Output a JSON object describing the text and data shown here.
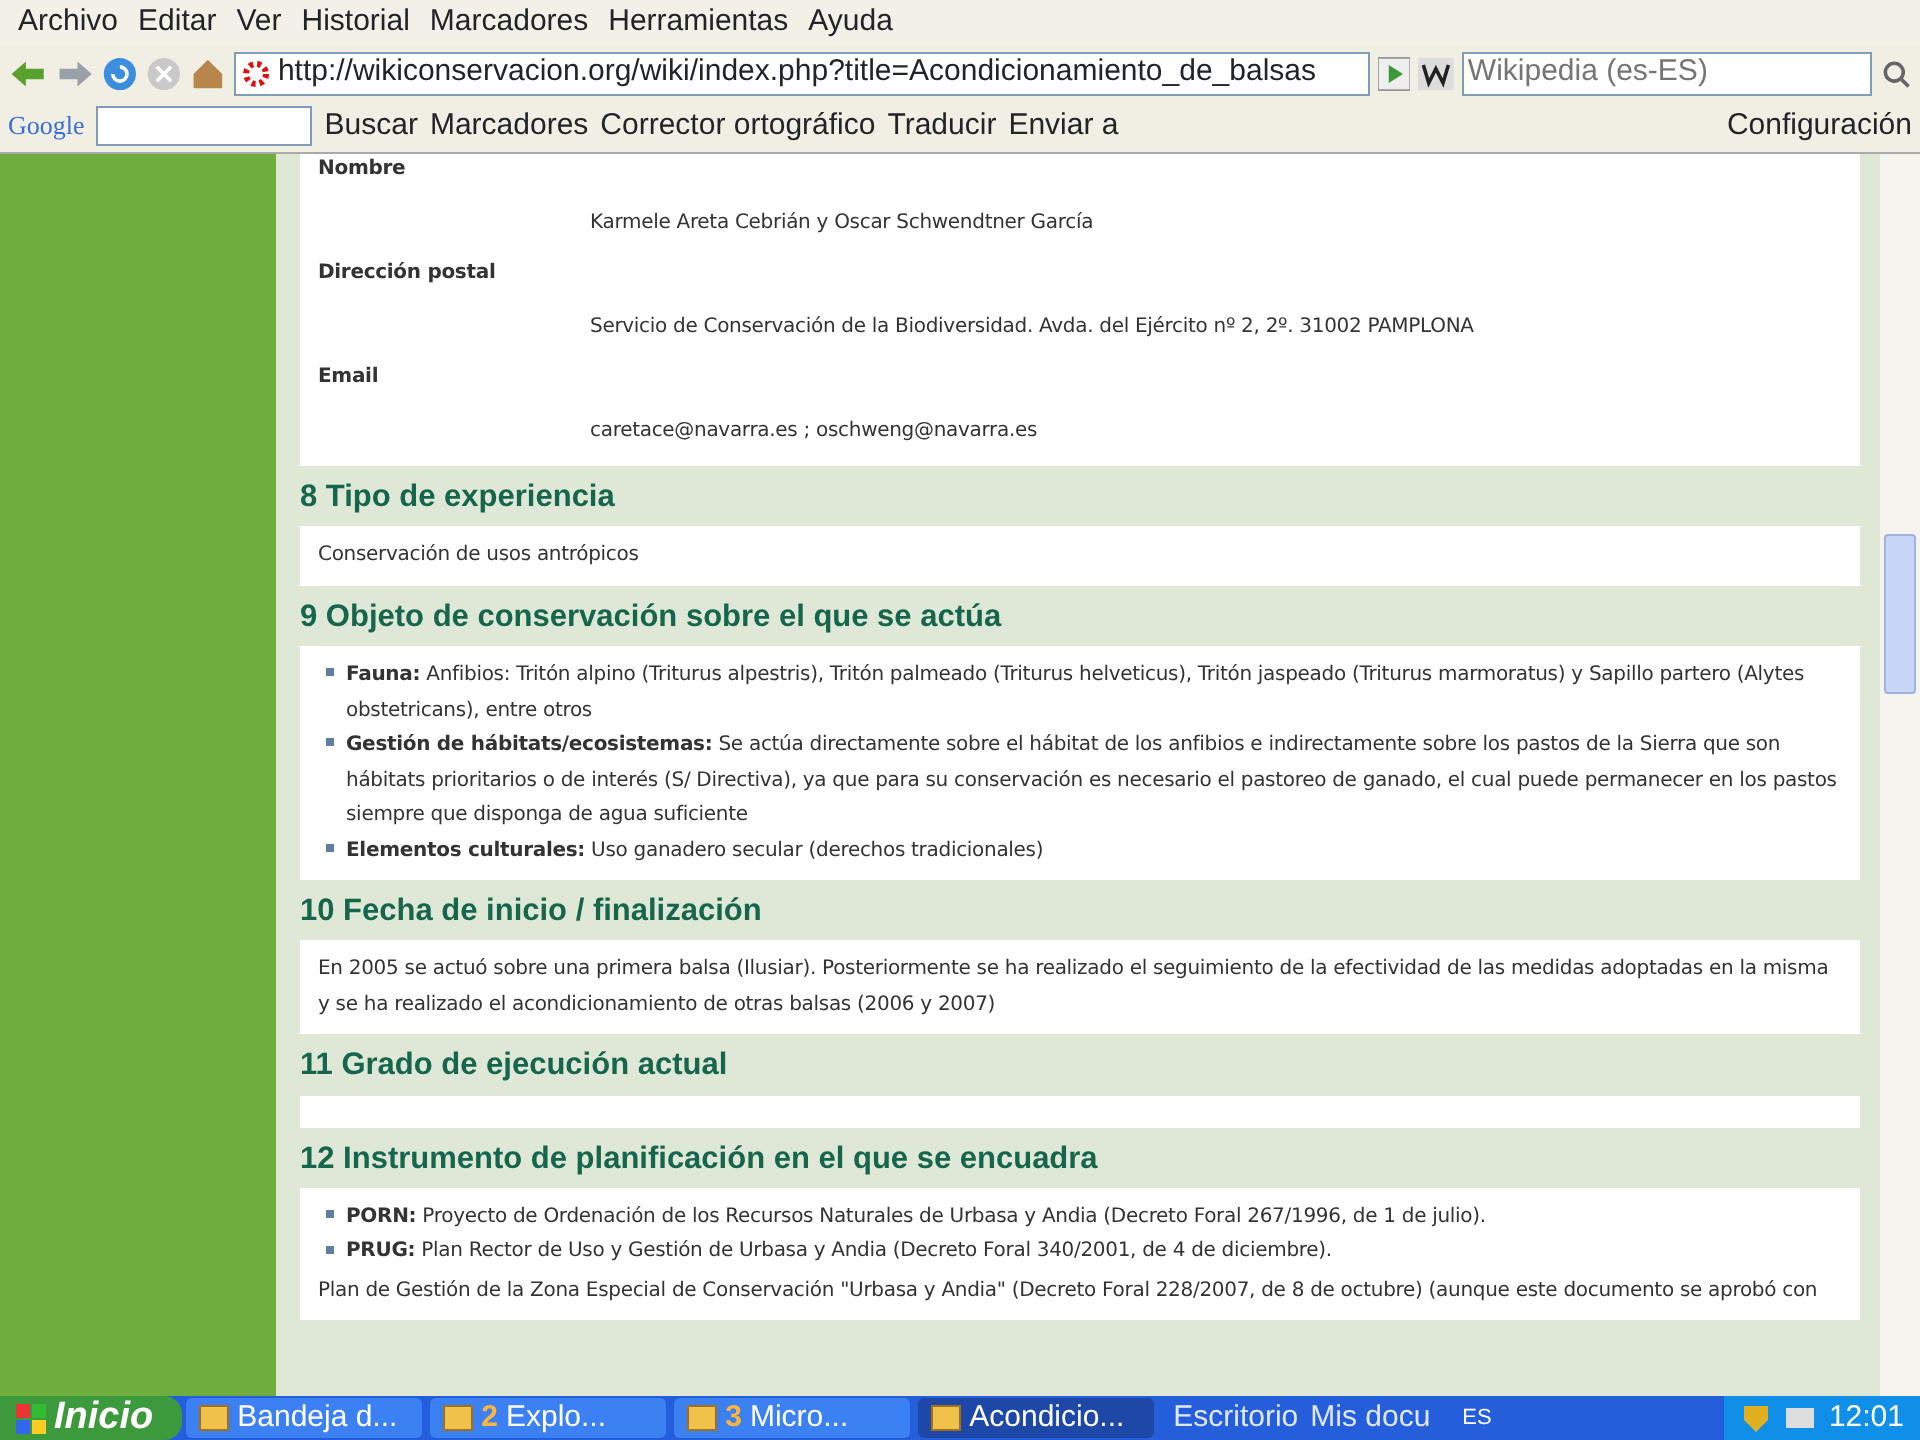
{
  "menu": [
    "Archivo",
    "Editar",
    "Ver",
    "Historial",
    "Marcadores",
    "Herramientas",
    "Ayuda"
  ],
  "navigation": {
    "url": "http://wikiconservacion.org/wiki/index.php?title=Acondicionamiento_de_balsas",
    "search_placeholder": "Wikipedia (es-ES)"
  },
  "google_toolbar": {
    "logo": "Google",
    "items": [
      "Buscar",
      "Marcadores",
      "Corrector ortográfico",
      "Traducir",
      "Enviar a"
    ],
    "settings": "Configuración"
  },
  "contact": [
    {
      "label": "Nombre",
      "value": "Karmele Areta Cebrián y Oscar Schwendtner García"
    },
    {
      "label": "Dirección postal",
      "value": "Servicio de Conservación de la Biodiversidad. Avda. del Ejército nº 2, 2º. 31002 PAMPLONA"
    },
    {
      "label": "Email",
      "value": "caretace@navarra.es ; oschweng@navarra.es"
    }
  ],
  "sections": [
    {
      "heading": "8 Tipo de experiencia",
      "paragraphs": [
        "Conservación de usos antrópicos"
      ]
    },
    {
      "heading": "9 Objeto de conservación sobre el que se actúa",
      "items": [
        "**Fauna:** Anfibios: Tritón alpino (Triturus alpestris), Tritón palmeado (Triturus helveticus), Tritón jaspeado (Triturus marmoratus) y Sapillo partero (Alytes obstetricans), entre otros",
        "**Gestión de hábitats/ecosistemas:** Se actúa directamente sobre el hábitat de los anfibios e indirectamente sobre los pastos de la Sierra que son hábitats prioritarios o de interés (S/ Directiva), ya que para su conservación es necesario el pastoreo de ganado, el cual puede permanecer en los pastos siempre que disponga de agua suficiente",
        "**Elementos culturales:** Uso ganadero secular (derechos tradicionales)"
      ]
    },
    {
      "heading": "10 Fecha de inicio / finalización",
      "paragraphs": [
        "En 2005 se actuó sobre una primera balsa (Ilusiar). Posteriormente se ha realizado el seguimiento de la efectividad de las medidas adoptadas en la misma y se ha realizado el acondicionamiento de otras balsas (2006 y 2007)"
      ]
    },
    {
      "heading": "11 Grado de ejecución actual"
    },
    {
      "heading": "12 Instrumento de planificación en el que se encuadra",
      "items": [
        "**PORN:** Proyecto de Ordenación de los Recursos Naturales de Urbasa y Andia (Decreto Foral 267/1996, de 1 de julio).",
        "**PRUG:** Plan Rector de Uso y Gestión de Urbasa y Andia (Decreto Foral 340/2001, de 4 de diciembre)."
      ],
      "paragraphs": [
        "Plan de Gestión de la Zona Especial de Conservación \"Urbasa y Andia\" (Decreto Foral 228/2007, de 8 de octubre) (aunque este documento se aprobó con"
      ]
    }
  ],
  "taskbar": {
    "start": "Inicio",
    "tasks": [
      {
        "label": "Bandeja d...",
        "selected": false
      },
      {
        "count": "2",
        "label": "Explo...",
        "selected": false
      },
      {
        "count": "3",
        "label": "Micro...",
        "selected": false
      },
      {
        "label": "Acondicio...",
        "selected": true
      }
    ],
    "quick_links": [
      "Escritorio",
      "Mis docu"
    ],
    "language": "ES",
    "clock": "12:01"
  }
}
